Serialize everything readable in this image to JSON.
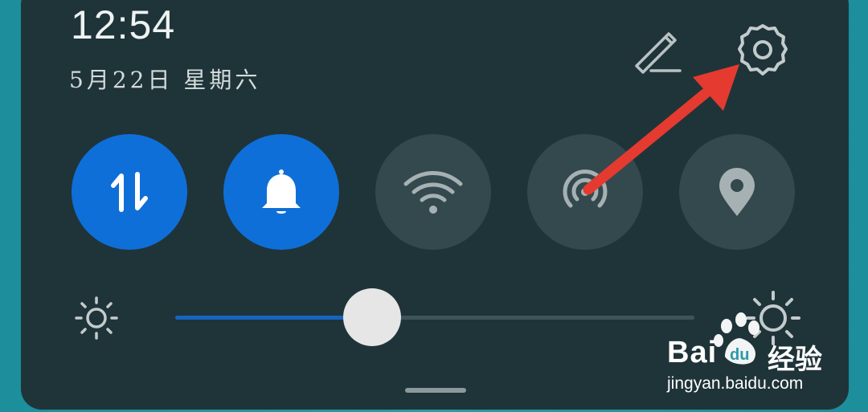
{
  "status": {
    "time": "12:54",
    "date": "5月22日 星期六"
  },
  "header": {
    "edit_icon": "pencil-icon",
    "settings_icon": "gear-icon"
  },
  "tiles": [
    {
      "name": "mobile-data",
      "icon": "data-transfer-icon",
      "state": "on"
    },
    {
      "name": "sound",
      "icon": "bell-icon",
      "state": "on"
    },
    {
      "name": "wifi",
      "icon": "wifi-icon",
      "state": "off"
    },
    {
      "name": "hotspot",
      "icon": "hotspot-icon",
      "state": "off"
    },
    {
      "name": "location",
      "icon": "location-pin-icon",
      "state": "off"
    }
  ],
  "brightness": {
    "level": 0.38,
    "min_icon": "sun-small-icon",
    "max_icon": "sun-large-icon"
  },
  "annotation": {
    "arrow_color": "#e53a30",
    "points_to": "settings"
  },
  "watermark": {
    "brand_left": "Bai",
    "brand_right": "经验",
    "url": "jingyan.baidu.com"
  },
  "colors": {
    "accent": "#0f6fd8",
    "panel": "#1f3439",
    "tile_off": "#34494d"
  }
}
